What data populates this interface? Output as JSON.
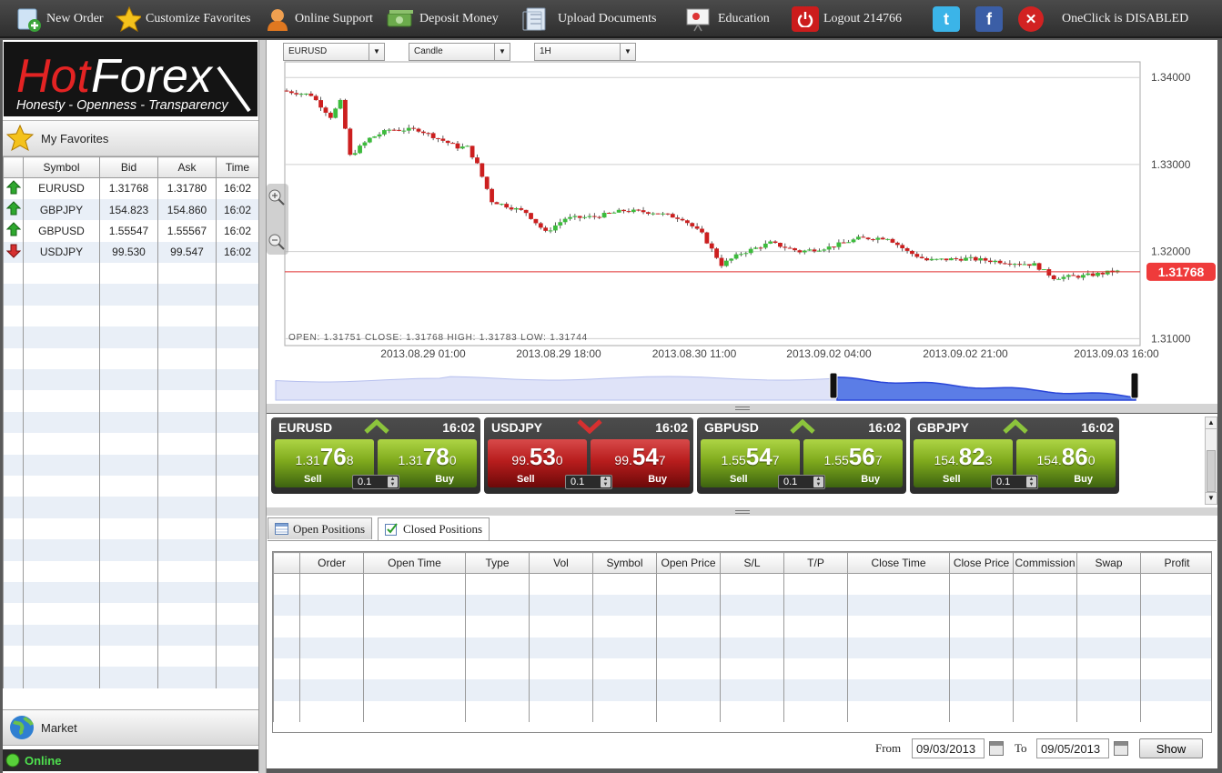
{
  "toolbar": {
    "new_order": "New Order",
    "customize_favorites": "Customize Favorites",
    "online_support": "Online Support",
    "deposit_money": "Deposit Money",
    "upload_documents": "Upload Documents",
    "education": "Education",
    "logout": "Logout 214766",
    "twitter_glyph": "t",
    "facebook_glyph": "f",
    "close_glyph": "✕",
    "oneclick_status": "OneClick is DISABLED"
  },
  "logo": {
    "brand_hot": "Hot",
    "brand_forex": "Forex",
    "tagline": "Honesty - Openness - Transparency"
  },
  "favorites": {
    "title": "My Favorites",
    "columns": [
      "Symbol",
      "Bid",
      "Ask",
      "Time"
    ],
    "rows": [
      {
        "direction": "up",
        "symbol": "EURUSD",
        "bid": "1.31768",
        "ask": "1.31780",
        "time": "16:02"
      },
      {
        "direction": "up",
        "symbol": "GBPJPY",
        "bid": "154.823",
        "ask": "154.860",
        "time": "16:02"
      },
      {
        "direction": "up",
        "symbol": "GBPUSD",
        "bid": "1.55547",
        "ask": "1.55567",
        "time": "16:02"
      },
      {
        "direction": "down",
        "symbol": "USDJPY",
        "bid": "99.530",
        "ask": "99.547",
        "time": "16:02"
      }
    ]
  },
  "market_label": "Market",
  "connection_status": "Online",
  "chart": {
    "symbol_select": "EURUSD",
    "type_select": "Candle",
    "timeframe_select": "1H",
    "price_labels": [
      "1.34000",
      "1.33000",
      "1.32000",
      "1.31000"
    ],
    "current_price": "1.31768",
    "ohlc_text": "OPEN: 1.31751   CLOSE: 1.31768   HIGH: 1.31783   LOW: 1.31744",
    "time_labels": [
      "2013.08.29 01:00",
      "2013.08.29 18:00",
      "2013.08.30 11:00",
      "2013.09.02 04:00",
      "2013.09.02 21:00",
      "2013.09.03 16:00"
    ],
    "colors": {
      "up": "#3cbc3c",
      "down": "#cc1f1f",
      "price_line": "#e03030",
      "grid": "#cfcfcf",
      "navigator": "#2a46d8"
    }
  },
  "quotes": [
    {
      "symbol": "EURUSD",
      "time": "16:02",
      "direction": "up",
      "color": "green",
      "sell": {
        "small": "1.31",
        "big": "76",
        "tail": "8"
      },
      "buy": {
        "small": "1.31",
        "big": "78",
        "tail": "0"
      },
      "sell_label": "Sell",
      "buy_label": "Buy",
      "lot": "0.1"
    },
    {
      "symbol": "USDJPY",
      "time": "16:02",
      "direction": "down",
      "color": "red",
      "sell": {
        "small": "99.",
        "big": "53",
        "tail": "0"
      },
      "buy": {
        "small": "99.",
        "big": "54",
        "tail": "7"
      },
      "sell_label": "Sell",
      "buy_label": "Buy",
      "lot": "0.1"
    },
    {
      "symbol": "GBPUSD",
      "time": "16:02",
      "direction": "up",
      "color": "green",
      "sell": {
        "small": "1.55",
        "big": "54",
        "tail": "7"
      },
      "buy": {
        "small": "1.55",
        "big": "56",
        "tail": "7"
      },
      "sell_label": "Sell",
      "buy_label": "Buy",
      "lot": "0.1"
    },
    {
      "symbol": "GBPJPY",
      "time": "16:02",
      "direction": "up",
      "color": "green",
      "sell": {
        "small": "154.",
        "big": "82",
        "tail": "3"
      },
      "buy": {
        "small": "154.",
        "big": "86",
        "tail": "0"
      },
      "sell_label": "Sell",
      "buy_label": "Buy",
      "lot": "0.1"
    }
  ],
  "positions": {
    "tabs": [
      {
        "label": "Open Positions",
        "active": false
      },
      {
        "label": "Closed Positions",
        "active": true
      }
    ],
    "columns": [
      "",
      "Order",
      "Open Time",
      "Type",
      "Vol",
      "Symbol",
      "Open Price",
      "S/L",
      "T/P",
      "Close Time",
      "Close Price",
      "Commission",
      "Swap",
      "Profit"
    ],
    "from_label": "From",
    "from_value": "09/03/2013",
    "to_label": "To",
    "to_value": "09/05/2013",
    "show_label": "Show"
  }
}
